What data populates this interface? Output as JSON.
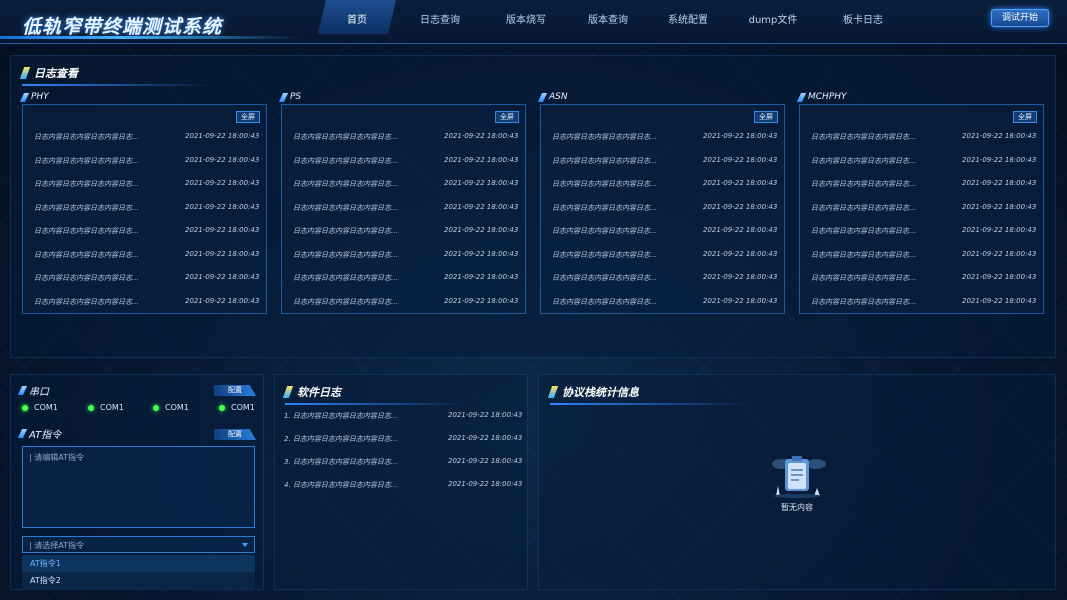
{
  "header": {
    "title": "低轨窄带终端测试系统",
    "nav": [
      "首页",
      "日志查询",
      "版本烧写",
      "版本查询",
      "系统配置",
      "dump文件",
      "板卡日志"
    ],
    "active_nav": "首页",
    "start_button": "调试开始"
  },
  "log_view": {
    "title": "日志查看",
    "full_label": "全屏",
    "panels": [
      {
        "name": "PHY"
      },
      {
        "name": "PS"
      },
      {
        "name": "ASN"
      },
      {
        "name": "MCHPHY"
      }
    ],
    "row_text": "日志内容日志内容日志内容日志...",
    "row_time": "2021-09-22  18:00:43"
  },
  "serial": {
    "title": "串口",
    "config_label": "配置",
    "ports": [
      "COM1",
      "COM1",
      "COM1",
      "COM1"
    ]
  },
  "at": {
    "title": "AT指令",
    "config_label": "配置",
    "textarea_placeholder": "| 请编辑AT指令",
    "select_placeholder": "| 请选择AT指令",
    "options": [
      "AT指令1",
      "AT指令2"
    ]
  },
  "software_log": {
    "title": "软件日志",
    "rows": [
      {
        "text": "1. 日志内容日志内容日志内容日志...",
        "time": "2021-09-22  18:00:43"
      },
      {
        "text": "2. 日志内容日志内容日志内容日志...",
        "time": "2021-09-22  18:00:43"
      },
      {
        "text": "3. 日志内容日志内容日志内容日志...",
        "time": "2021-09-22  18:00:43"
      },
      {
        "text": "4. 日志内容日志内容日志内容日志...",
        "time": "2021-09-22  18:00:43"
      }
    ]
  },
  "protocol": {
    "title": "协议栈统计信息",
    "empty_text": "暂无内容"
  },
  "colors": {
    "accent": "#2b7cd6",
    "active_dot": "#4dff4d"
  }
}
